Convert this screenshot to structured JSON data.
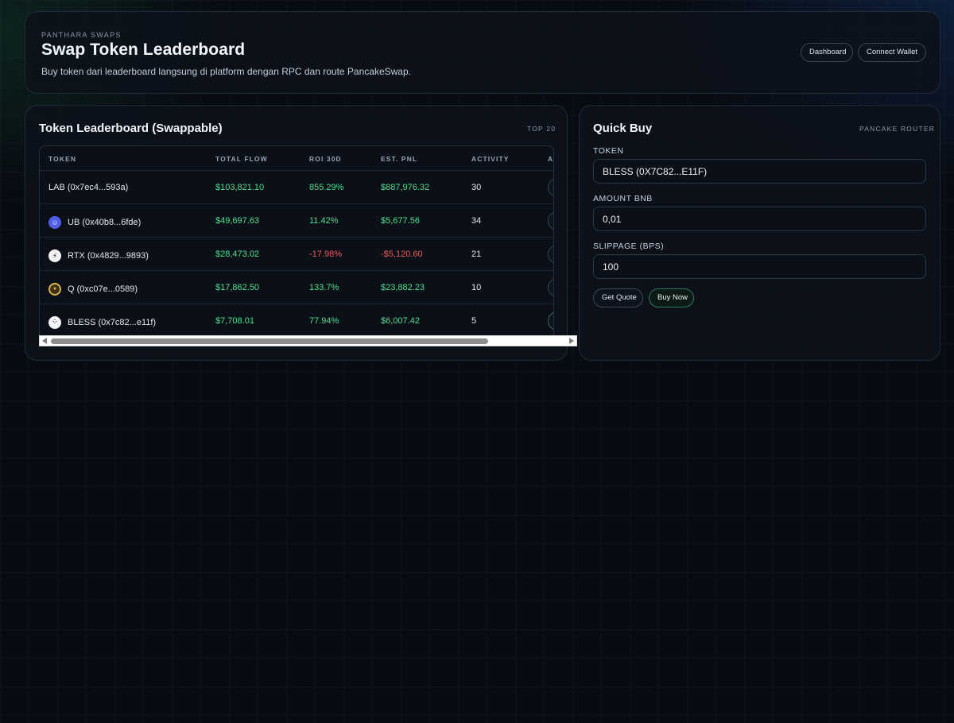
{
  "header": {
    "eyebrow": "PANTHARA SWAPS",
    "title": "Swap Token Leaderboard",
    "subtitle": "Buy token dari leaderboard langsung di platform dengan RPC dan route PancakeSwap.",
    "nav": {
      "dashboard_label": "Dashboard",
      "connect_wallet_label": "Connect Wallet"
    }
  },
  "leaderboard": {
    "title": "Token Leaderboard (Swappable)",
    "tag": "TOP 20",
    "columns": {
      "token": "TOKEN",
      "total_flow": "TOTAL FLOW",
      "roi": "ROI 30D",
      "pnl": "EST. PNL",
      "activity": "ACTIVITY",
      "action": "A"
    },
    "rows": [
      {
        "token": "LAB (0x7ec4...593a)",
        "icon": "none",
        "total_flow": "$103,821.10",
        "roi": "855.29%",
        "pnl": "$887,976.32",
        "activity": "30",
        "trend": "positive"
      },
      {
        "token": "UB (0x40b8...6fde)",
        "icon": "ub-token-icon",
        "total_flow": "$49,697.63",
        "roi": "11.42%",
        "pnl": "$5,677.56",
        "activity": "34",
        "trend": "positive"
      },
      {
        "token": "RTX (0x4829...9893)",
        "icon": "rtx-token-icon",
        "total_flow": "$28,473.02",
        "roi": "-17.98%",
        "pnl": "-$5,120.60",
        "activity": "21",
        "trend": "negative"
      },
      {
        "token": "Q (0xc07e...0589)",
        "icon": "q-token-icon",
        "total_flow": "$17,862.50",
        "roi": "133.7%",
        "pnl": "$23,882.23",
        "activity": "10",
        "trend": "positive"
      },
      {
        "token": "BLESS (0x7c82...e11f)",
        "icon": "bless-token-icon",
        "total_flow": "$7,708.01",
        "roi": "77.94%",
        "pnl": "$6,007.42",
        "activity": "5",
        "trend": "positive"
      }
    ],
    "colors": {
      "positive": "#4ee08c",
      "negative": "#ef5b5b"
    }
  },
  "quick_buy": {
    "title": "Quick Buy",
    "tag": "PANCAKE ROUTER",
    "token_label": "TOKEN",
    "token_value": "BLESS (0X7C82...E11F)",
    "amount_label": "AMOUNT BNB",
    "amount_value": "0,01",
    "slippage_label": "SLIPPAGE (BPS)",
    "slippage_value": "100",
    "get_quote_label": "Get Quote",
    "buy_now_label": "Buy Now"
  }
}
